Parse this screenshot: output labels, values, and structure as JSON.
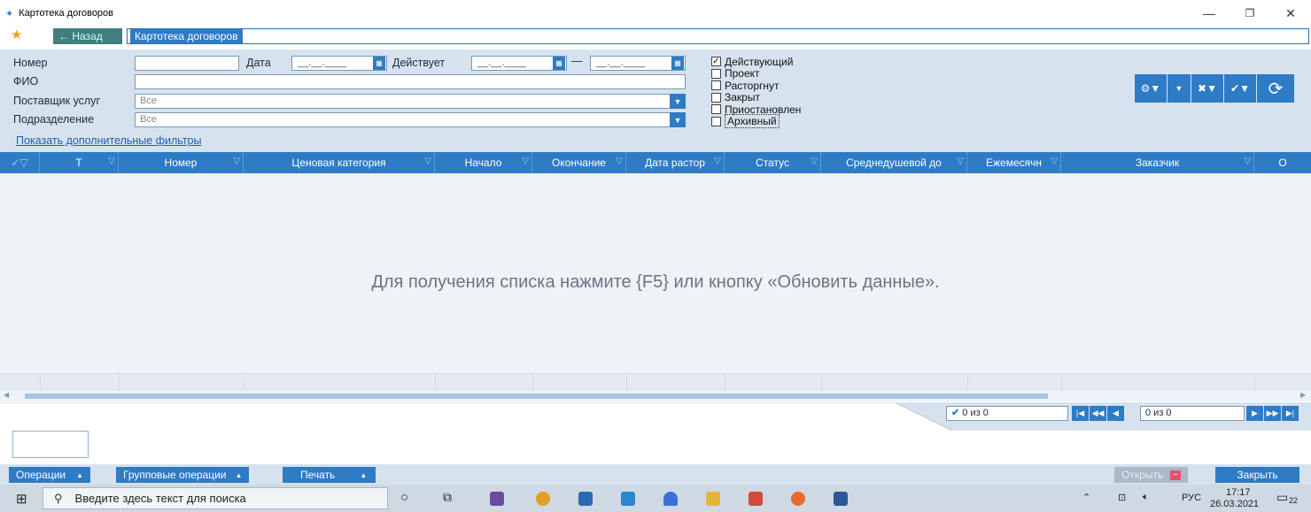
{
  "window": {
    "title": "Картотека договоров",
    "minimize": "—",
    "maximize": "❐",
    "close": "✕"
  },
  "nav": {
    "back": "← Назад",
    "current": "Картотека договоров"
  },
  "filters": {
    "number_label": "Номер",
    "date_label": "Дата",
    "date_value": "__.__.____",
    "active_label": "Действует",
    "active_from": "__.__.____",
    "active_to": "__.__.____",
    "dash": "—",
    "fio_label": "ФИО",
    "provider_label": "Поставщик услуг",
    "provider_value": "Все",
    "division_label": "Подразделение",
    "division_value": "Все",
    "more_filters": "Показать дополнительные фильтры",
    "statuses": [
      {
        "label": "Действующий",
        "checked": true
      },
      {
        "label": "Проект",
        "checked": false
      },
      {
        "label": "Расторгнут",
        "checked": false
      },
      {
        "label": "Закрыт",
        "checked": false
      },
      {
        "label": "Приостановлен",
        "checked": false
      },
      {
        "label": "Архивный",
        "checked": false
      }
    ]
  },
  "grid": {
    "columns": [
      "Т",
      "Номер",
      "Ценовая категория",
      "Начало",
      "Окончание",
      "Дата растор",
      "Статус",
      "Среднедушевой до",
      "Ежемесячн",
      "Заказчик",
      "О"
    ],
    "empty_text": "Для получения списка нажмите {F5} или кнопку «Обновить данные»."
  },
  "pager": {
    "selected": "0 из 0",
    "page": "0 из 0"
  },
  "actions": {
    "operations": "Операции",
    "group_operations": "Групповые операции",
    "print": "Печать",
    "open": "Открыть",
    "close": "Закрыть"
  },
  "taskbar": {
    "search_placeholder": "Введите здесь текст для поиска",
    "lang": "РУС",
    "time": "17:17",
    "date": "26.03.2021",
    "notifications": "22"
  }
}
